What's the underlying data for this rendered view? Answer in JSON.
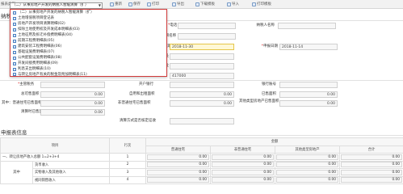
{
  "toolbar": {
    "report_type_label": "报表类型",
    "report_type_value": "（二）从事房地产开发的纳税人暂缓清算（扩）",
    "buttons": [
      {
        "label": "重新",
        "icon": "refresh-icon"
      },
      {
        "label": "保存",
        "icon": "save-icon"
      },
      {
        "label": "打印",
        "icon": "print-icon"
      },
      {
        "label": "导出",
        "icon": "export-icon"
      },
      {
        "label": "下载模板",
        "icon": "download-icon"
      },
      {
        "label": "导入",
        "icon": "import-icon"
      },
      {
        "label": "打印模板",
        "icon": "print-template-icon"
      }
    ]
  },
  "dropdown_options": [
    "（二）从事房地产开发的纳税人暂缓清算（扩）",
    "土地增值税项目登记表",
    "房地产开发项目清算明细(02)",
    "扣除土地使用权及开发成本明细表(03)",
    "土地征用及拆迁补偿费明细表(04)",
    "前期工程费明细表(05)",
    "建筑安装工程费明细表(06)",
    "基础设施费明细表(07)",
    "公共配套设施费明细表(08)",
    "开发间接费用明细表(09)",
    "利息支出明细表(10)",
    "与转让房地产有关的税金及附加明细表(11)"
  ],
  "taxpayer": {
    "section_title": "纳税人",
    "name_label": "纳税人名称",
    "phone_label": "电话",
    "project_label": "项目名称",
    "declare_date_label": "申报日期",
    "declare_date_value": "2018-11-14",
    "period_label": "所属期",
    "period_value": "2018-11-30",
    "address_label": "地址",
    "zip_label": "邮编",
    "postcode_value": "417000",
    "industry_label": "行业",
    "bank_label": "开户银行",
    "account_label": "银行账号",
    "total_area_label": "总可售面积",
    "total_area_value": "0.00",
    "sold_area_label": "已售面积",
    "sold_area_value": "0.00",
    "self_use_area_label": "自用和出租面积",
    "self_use_area_value": "0.00",
    "clearing_area_label": "清算时已售面积",
    "clearing_area_value": "0.00",
    "ordinary_area_label": "其中：普通住宅已售面积",
    "ordinary_area_value": "0.00",
    "nonordinary_area_label": "非普通住宅已售面积",
    "nonordinary_area_value": "0.00",
    "other_area_label": "其他类型房地产已售面积",
    "other_area_value": "0.00",
    "clearing_method_label": "清算方式是否核定征收"
  },
  "declare_section": {
    "title": "申报表信息"
  },
  "table": {
    "group_header": "金额",
    "headers": [
      "项目",
      "行次",
      "普通住宅",
      "非普通住宅",
      "其他类型房地产",
      "合计"
    ],
    "rows": [
      {
        "item": "一、转让房地产收入总额 1=2+3+4",
        "line": "1",
        "v": [
          "0.00",
          "0.00",
          "0.00",
          "0.00"
        ]
      },
      {
        "item": "货币收入",
        "line": "2",
        "v": [
          "0.00",
          "0.00",
          "0.00",
          "0.00"
        ]
      },
      {
        "item": "实物收入及其他收入",
        "line": "3",
        "v": [
          "0.00",
          "0.00",
          "0.00",
          "0.00"
        ]
      },
      {
        "item": "视同销售收入",
        "line": "4",
        "v": [
          "0.00",
          "0.00",
          "0.00",
          "0.00"
        ]
      }
    ],
    "sub_label": "其中"
  }
}
